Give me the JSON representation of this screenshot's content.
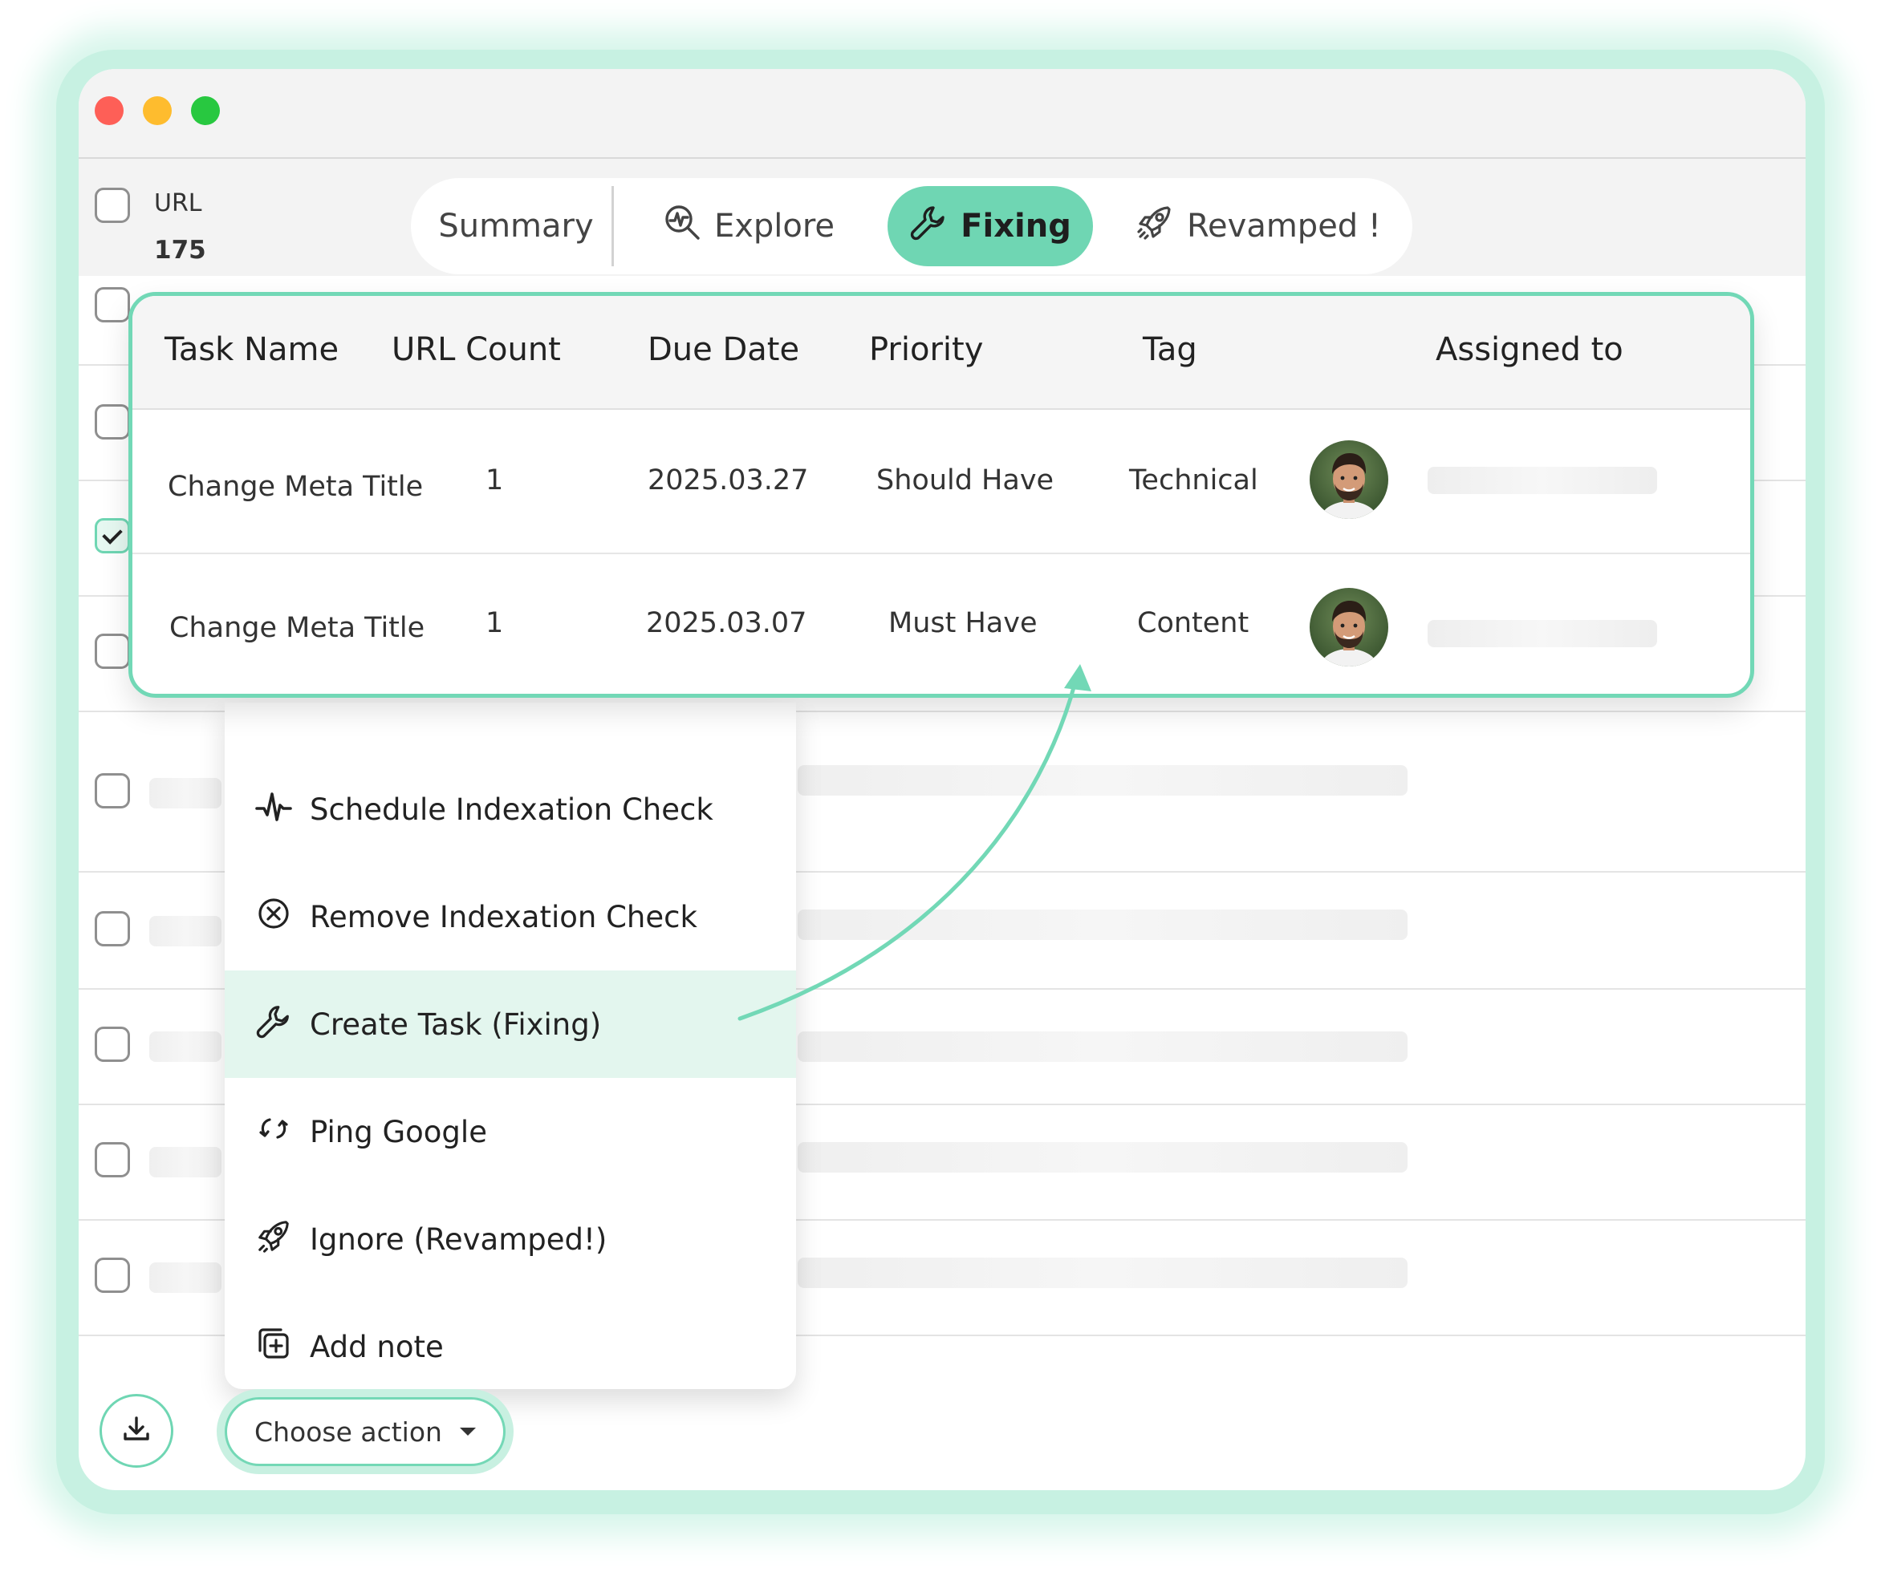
{
  "window": {
    "controls": [
      "close",
      "minimize",
      "maximize"
    ]
  },
  "header": {
    "url_label": "URL",
    "url_count": "175",
    "tabs": [
      {
        "label": "Summary",
        "icon": "none",
        "active": false
      },
      {
        "label": "Explore",
        "icon": "search-chart-icon",
        "active": false
      },
      {
        "label": "Fixing",
        "icon": "wrench-icon",
        "active": true
      },
      {
        "label": "Revamped !",
        "icon": "rocket-icon",
        "active": false
      }
    ]
  },
  "task_table": {
    "columns": [
      "Task Name",
      "URL Count",
      "Due Date",
      "Priority",
      "Tag",
      "Assigned to"
    ],
    "rows": [
      {
        "task_name": "Change Meta Title",
        "url_count": "1",
        "due_date": "2025.03.27",
        "priority": "Should Have",
        "tag": "Technical"
      },
      {
        "task_name": "Change Meta Title",
        "url_count": "1",
        "due_date": "2025.03.07",
        "priority": "Must Have",
        "tag": "Content"
      }
    ]
  },
  "action_menu": {
    "items": [
      {
        "label": "Schedule Indexation Check",
        "icon": "pulse-icon",
        "highlighted": false
      },
      {
        "label": "Remove Indexation Check",
        "icon": "circle-x-icon",
        "highlighted": false
      },
      {
        "label": "Create Task (Fixing)",
        "icon": "wrench-icon",
        "highlighted": true
      },
      {
        "label": "Ping Google",
        "icon": "refresh-icon",
        "highlighted": false
      },
      {
        "label": "Ignore (Revamped!)",
        "icon": "rocket-icon",
        "highlighted": false
      },
      {
        "label": "Add note",
        "icon": "add-note-icon",
        "highlighted": false
      }
    ]
  },
  "footer": {
    "choose_action_label": "Choose action",
    "download_icon": "download-icon"
  },
  "colors": {
    "accent": "#6fd6b3",
    "accent_light": "#e3f6ee",
    "glow": "#c7f1e2"
  }
}
